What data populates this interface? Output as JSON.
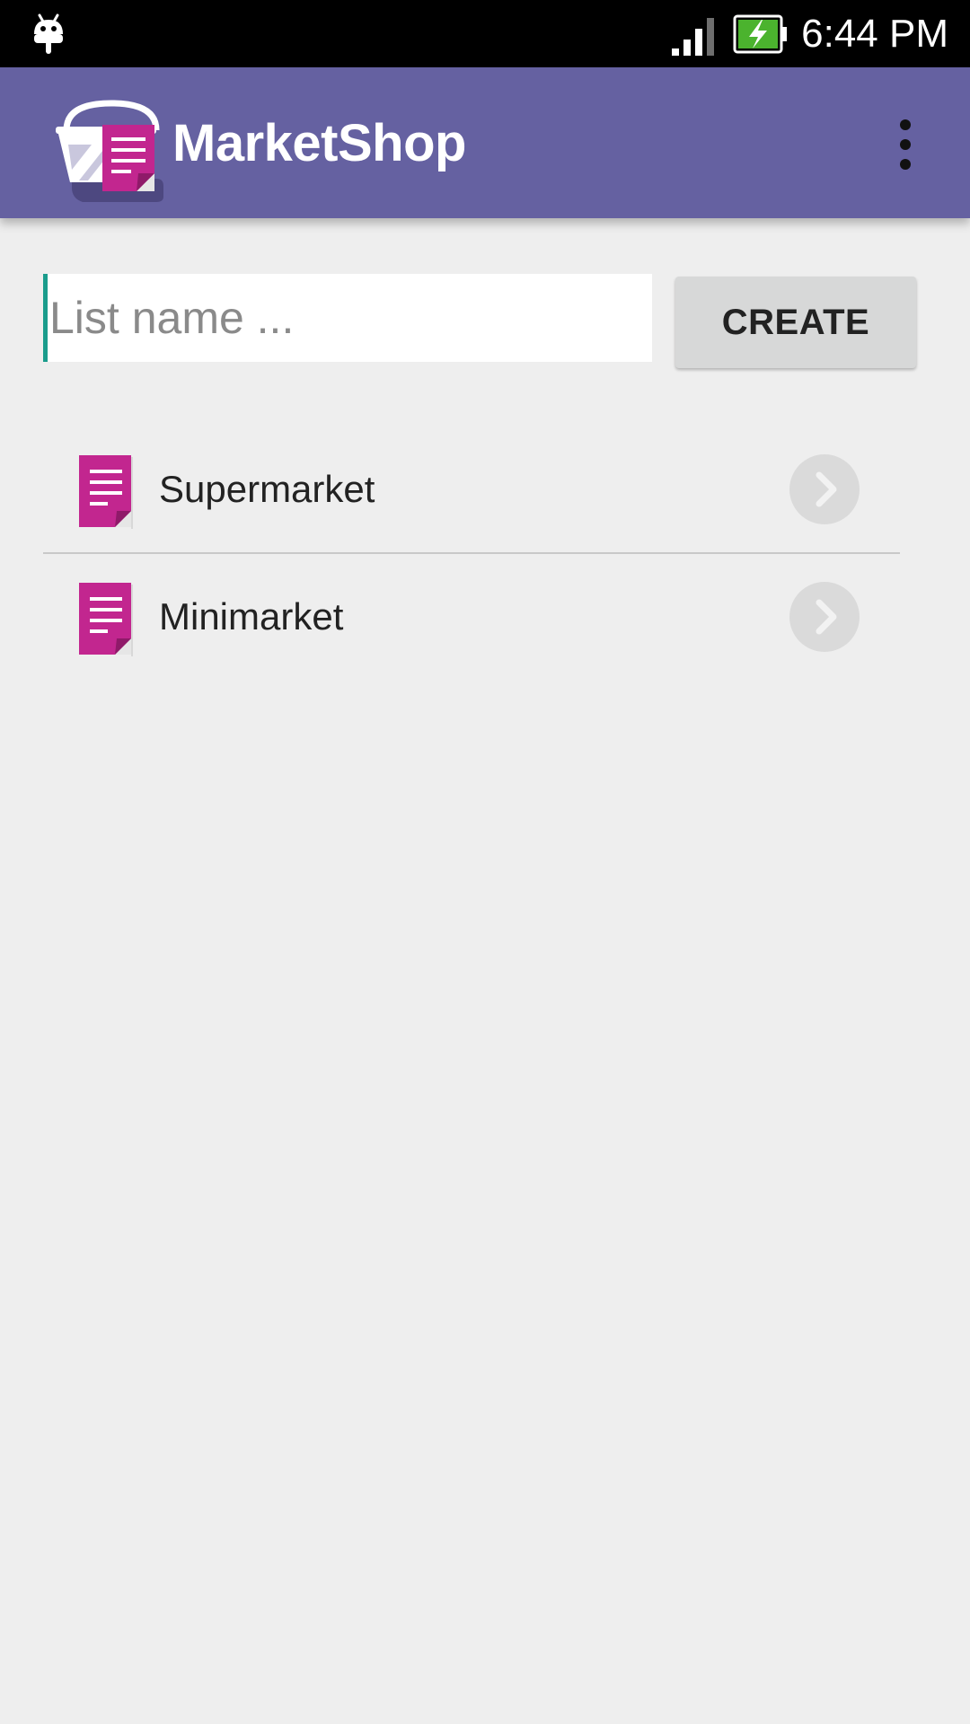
{
  "status_bar": {
    "time": "6:44 PM",
    "icons": [
      "android-icon",
      "signal-icon",
      "battery-charging-icon"
    ]
  },
  "app_bar": {
    "title": "MarketShop",
    "logo_icon": "basket-list-logo-icon",
    "menu_icon": "overflow-menu-icon"
  },
  "create_form": {
    "input_value": "",
    "input_placeholder": "List name ...",
    "button_label": "CREATE"
  },
  "lists": {
    "items": [
      {
        "label": "Supermarket",
        "icon": "document-icon",
        "action_icon": "chevron-right-icon"
      },
      {
        "label": "Minimarket",
        "icon": "document-icon",
        "action_icon": "chevron-right-icon"
      }
    ]
  },
  "colors": {
    "app_bar": "#6561a1",
    "status_bar": "#000000",
    "background": "#eeeeee",
    "accent_magenta": "#c2268f",
    "button_background": "#d7d8d8",
    "cursor_teal": "#1a9c8c",
    "battery_green": "#4bb32e"
  }
}
